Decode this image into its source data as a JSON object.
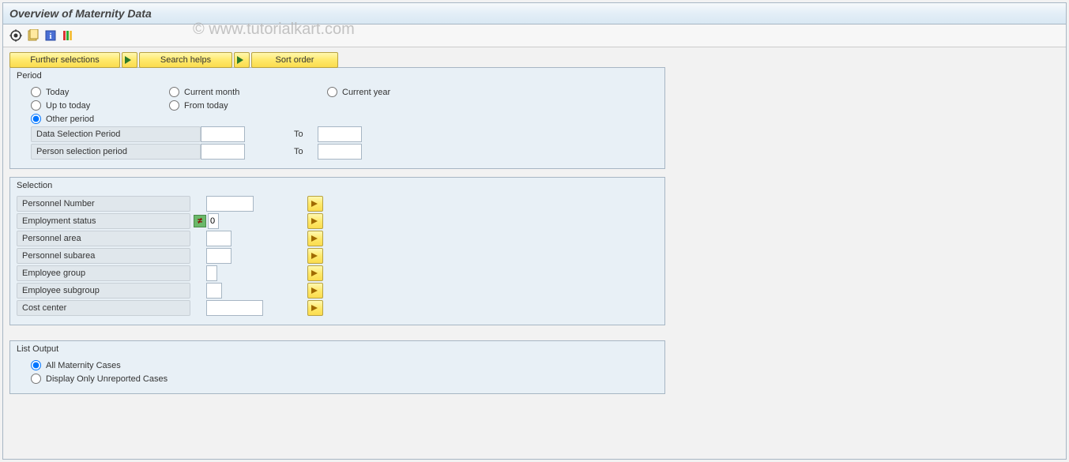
{
  "title": "Overview of Maternity Data",
  "watermark": "© www.tutorialkart.com",
  "topButtons": {
    "further": "Further selections",
    "searchHelps": "Search helps",
    "sortOrder": "Sort order"
  },
  "period": {
    "groupTitle": "Period",
    "radios": {
      "today": "Today",
      "currentMonth": "Current month",
      "currentYear": "Current year",
      "upToToday": "Up to today",
      "fromToday": "From today",
      "otherPeriod": "Other period"
    },
    "selectedRadio": "otherPeriod",
    "dataSelectionPeriod": "Data Selection Period",
    "personSelectionPeriod": "Person selection period",
    "to": "To",
    "values": {
      "dataFrom": "",
      "dataTo": "",
      "personFrom": "",
      "personTo": ""
    }
  },
  "selection": {
    "groupTitle": "Selection",
    "fields": {
      "personnelNumber": {
        "label": "Personnel Number",
        "value": "",
        "width": 60
      },
      "employmentStatus": {
        "label": "Employment status",
        "value": "0",
        "width": 14,
        "hasNotEqual": true
      },
      "personnelArea": {
        "label": "Personnel area",
        "value": "",
        "width": 32
      },
      "personnelSubarea": {
        "label": "Personnel subarea",
        "value": "",
        "width": 32
      },
      "employeeGroup": {
        "label": "Employee group",
        "value": "",
        "width": 14
      },
      "employeeSubgroup": {
        "label": "Employee subgroup",
        "value": "",
        "width": 20
      },
      "costCenter": {
        "label": "Cost center",
        "value": "",
        "width": 72
      }
    }
  },
  "listOutput": {
    "groupTitle": "List Output",
    "radios": {
      "all": "All Maternity Cases",
      "unreported": "Display Only Unreported Cases"
    },
    "selected": "all"
  }
}
